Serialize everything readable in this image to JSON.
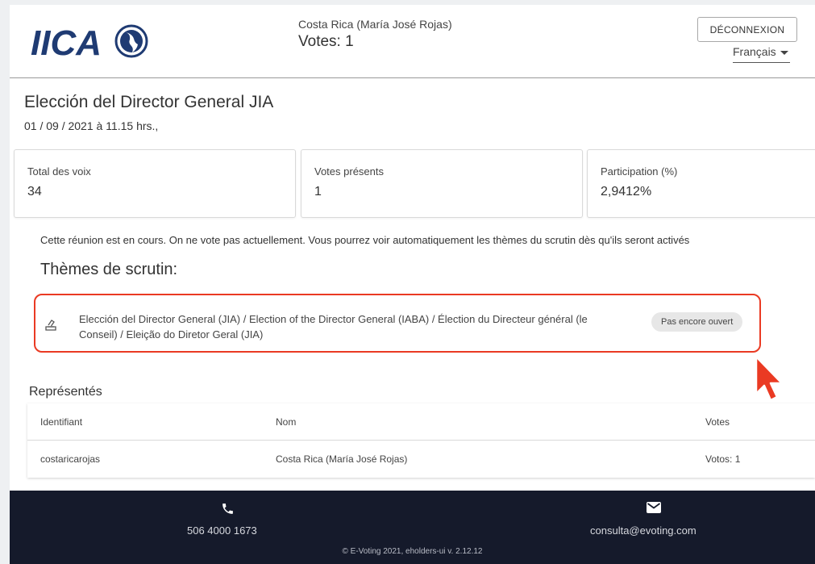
{
  "header": {
    "logo_text": "IICA",
    "user_name": "Costa Rica (María José Rojas)",
    "votes_label": "Votes: 1",
    "logout_label": "DÉCONNEXION",
    "language": "Français"
  },
  "election": {
    "title": "Elección del Director General JIA",
    "date": "01 / 09 / 2021 à 11.15 hrs.,"
  },
  "stats": [
    {
      "label": "Total des voix",
      "value": "34"
    },
    {
      "label": "Votes présents",
      "value": "1"
    },
    {
      "label": "Participation (%)",
      "value": "2,9412%"
    }
  ],
  "notice": "Cette réunion est en cours. On ne vote pas actuellement. Vous pourrez voir automatiquement les thèmes du scrutin dès qu'ils seront activés",
  "themes": {
    "heading": "Thèmes de scrutin:",
    "items": [
      {
        "text": "Elección del Director General (JIA) / Election of the Director General (IABA) / Élection du Directeur général (le Conseil) / Eleição do Diretor Geral (JIA)",
        "status": "Pas encore ouvert",
        "icon": "ballot-icon"
      }
    ]
  },
  "represented": {
    "heading": "Représentés",
    "columns": [
      "Identifiant",
      "Nom",
      "Votes"
    ],
    "rows": [
      [
        "costaricarojas",
        "Costa Rica (María José Rojas)",
        "Votos: 1"
      ]
    ]
  },
  "footer": {
    "phone": "506 4000 1673",
    "email": "consulta@evoting.com",
    "copyright": "© E-Voting 2021, eholders-ui v. 2.12.12"
  },
  "colors": {
    "highlight": "#ea3a23",
    "footer_bg": "#151a2b"
  }
}
